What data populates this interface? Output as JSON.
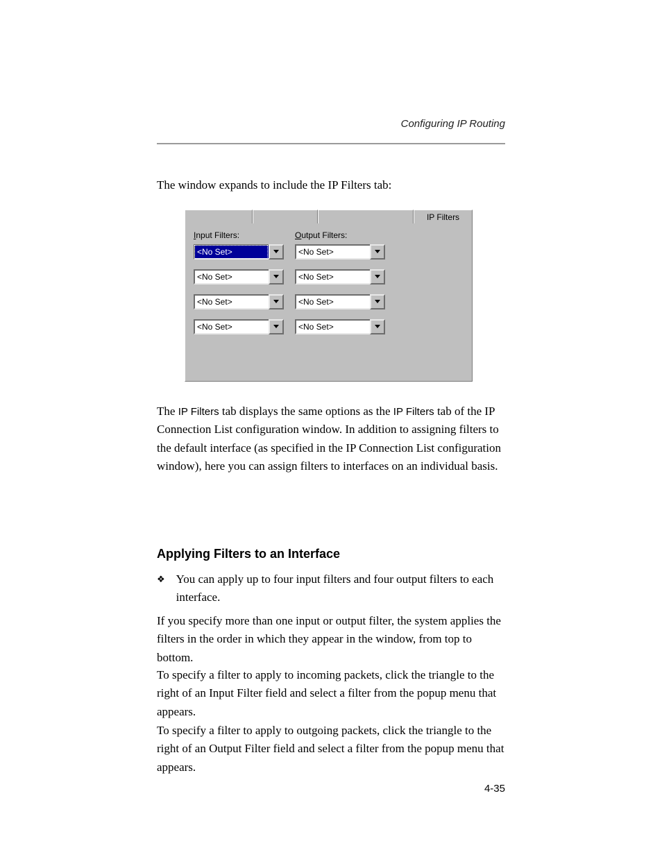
{
  "header": {
    "running_head": "Configuring IP Routing"
  },
  "intro": "The window expands to include the IP Filters tab:",
  "dialog": {
    "tab_active": "IP Filters",
    "input_label_pre": "I",
    "input_label_post": "nput Filters:",
    "output_label_pre": "O",
    "output_label_post": "utput Filters:",
    "no_set": "<No Set>",
    "input_filters": [
      "<No Set>",
      "<No Set>",
      "<No Set>",
      "<No Set>"
    ],
    "output_filters": [
      "<No Set>",
      "<No Set>",
      "<No Set>",
      "<No Set>"
    ]
  },
  "paragraphs": {
    "p1a": "The ",
    "p1b": "IP Filters",
    "p1c": " tab displays the same options as the ",
    "p1d": "IP Filters",
    "p1e": " tab of the IP Connection List configuration window. In addition to assigning filters to the default interface (as specified in the IP Connection List configuration window), here you can assign filters to interfaces on an individual basis.",
    "h3": "Applying Filters to an Interface",
    "bullet": "You can apply up to four input filters and four output filters to each interface.",
    "p2": "If you specify more than one input or output filter, the system applies the filters in the order in which they appear in the window, from top to bottom.",
    "p3": "To specify a filter to apply to incoming packets, click the triangle to the right of an Input Filter field and select a filter from the popup menu that appears.",
    "p4": "To specify a filter to apply to outgoing packets, click the triangle to the right of an Output Filter field and select a filter from the popup menu that appears."
  },
  "footer": {
    "pagenum": "4-35"
  }
}
